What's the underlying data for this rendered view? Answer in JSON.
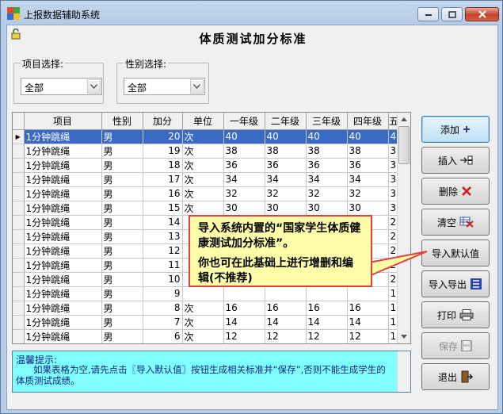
{
  "window": {
    "title": "上报数据辅助系统"
  },
  "page": {
    "title": "体质测试加分标准"
  },
  "filters": {
    "item": {
      "label": "项目选择:",
      "value": "全部"
    },
    "gender": {
      "label": "性别选择:",
      "value": "全部"
    }
  },
  "table": {
    "columns": [
      "项目",
      "性别",
      "加分",
      "单位",
      "一年级",
      "二年级",
      "三年级",
      "四年级",
      "五"
    ],
    "rows": [
      [
        "1分钟跳绳",
        "男",
        "20",
        "次",
        "40",
        "40",
        "40",
        "40",
        "4"
      ],
      [
        "1分钟跳绳",
        "男",
        "19",
        "次",
        "38",
        "38",
        "38",
        "38",
        "3"
      ],
      [
        "1分钟跳绳",
        "男",
        "18",
        "次",
        "36",
        "36",
        "36",
        "36",
        "3"
      ],
      [
        "1分钟跳绳",
        "男",
        "17",
        "次",
        "34",
        "34",
        "34",
        "34",
        "3"
      ],
      [
        "1分钟跳绳",
        "男",
        "16",
        "次",
        "32",
        "32",
        "32",
        "32",
        "3"
      ],
      [
        "1分钟跳绳",
        "男",
        "15",
        "次",
        "30",
        "30",
        "30",
        "30",
        "3"
      ],
      [
        "1分钟跳绳",
        "男",
        "14",
        "",
        "",
        "",
        "",
        "",
        "2"
      ],
      [
        "1分钟跳绳",
        "男",
        "13",
        "",
        "",
        "",
        "",
        "",
        "2"
      ],
      [
        "1分钟跳绳",
        "男",
        "12",
        "",
        "",
        "",
        "",
        "",
        "2"
      ],
      [
        "1分钟跳绳",
        "男",
        "11",
        "",
        "",
        "",
        "",
        "",
        "2"
      ],
      [
        "1分钟跳绳",
        "男",
        "10",
        "",
        "",
        "",
        "",
        "",
        "2"
      ],
      [
        "1分钟跳绳",
        "男",
        "9",
        "",
        "",
        "",
        "",
        "",
        "1"
      ],
      [
        "1分钟跳绳",
        "男",
        "8",
        "次",
        "16",
        "16",
        "16",
        "16",
        "1"
      ],
      [
        "1分钟跳绳",
        "男",
        "7",
        "次",
        "14",
        "14",
        "14",
        "14",
        "1"
      ],
      [
        "1分钟跳绳",
        "男",
        "6",
        "次",
        "12",
        "12",
        "12",
        "12",
        "1"
      ]
    ]
  },
  "buttons": {
    "add": "添加",
    "insert": "插入",
    "delete": "删除",
    "clear": "清空",
    "import_default": "导入默认值",
    "import_export": "导入导出",
    "print": "打印",
    "save": "保存",
    "exit": "退出"
  },
  "tips": {
    "head": "温馨提示:",
    "body": "如果表格为空,请先点击〖导入默认值〗按钮生成相关标准并“保存”,否则不能生成学生的体质测试成绩。"
  },
  "callout": {
    "line1": "导入系统内置的“国家学生体质健康测试加分标准”。",
    "line2": "你也可在此基础上进行增删和编辑(不推荐)"
  },
  "colors": {
    "selection": "#3a6ac4",
    "tips_bg": "#80ffff",
    "callout_bg": "#fffea8",
    "callout_border": "#e14040"
  }
}
